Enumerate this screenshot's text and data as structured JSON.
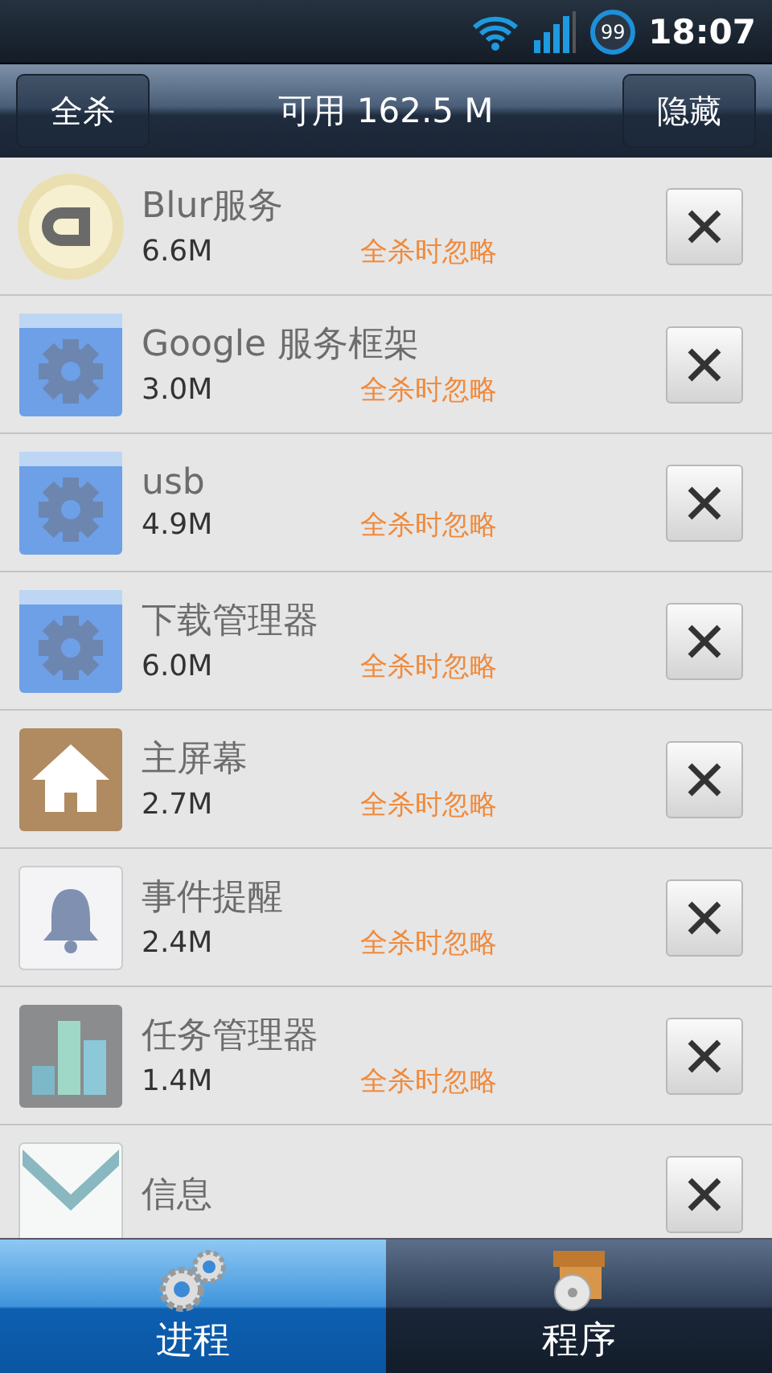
{
  "status_bar": {
    "battery": "99",
    "time": "18:07"
  },
  "toolbar": {
    "left_button": "全杀",
    "title": "可用 162.5 M",
    "right_button": "隐藏"
  },
  "processes": [
    {
      "kind": "blur",
      "name": "Blur服务",
      "size": "6.6M",
      "note": "全杀时忽略"
    },
    {
      "kind": "gear",
      "name": "Google 服务框架",
      "size": "3.0M",
      "note": "全杀时忽略"
    },
    {
      "kind": "gear",
      "name": "usb",
      "size": "4.9M",
      "note": "全杀时忽略"
    },
    {
      "kind": "gear",
      "name": "下载管理器",
      "size": "6.0M",
      "note": "全杀时忽略"
    },
    {
      "kind": "home",
      "name": "主屏幕",
      "size": "2.7M",
      "note": "全杀时忽略"
    },
    {
      "kind": "bell",
      "name": "事件提醒",
      "size": "2.4M",
      "note": "全杀时忽略"
    },
    {
      "kind": "meter",
      "name": "任务管理器",
      "size": "1.4M",
      "note": "全杀时忽略"
    },
    {
      "kind": "mail",
      "name": "信息"
    }
  ],
  "tabs": [
    {
      "label": "进程",
      "kind": "gears",
      "selected": true
    },
    {
      "label": "程序",
      "kind": "box",
      "selected": false
    }
  ]
}
